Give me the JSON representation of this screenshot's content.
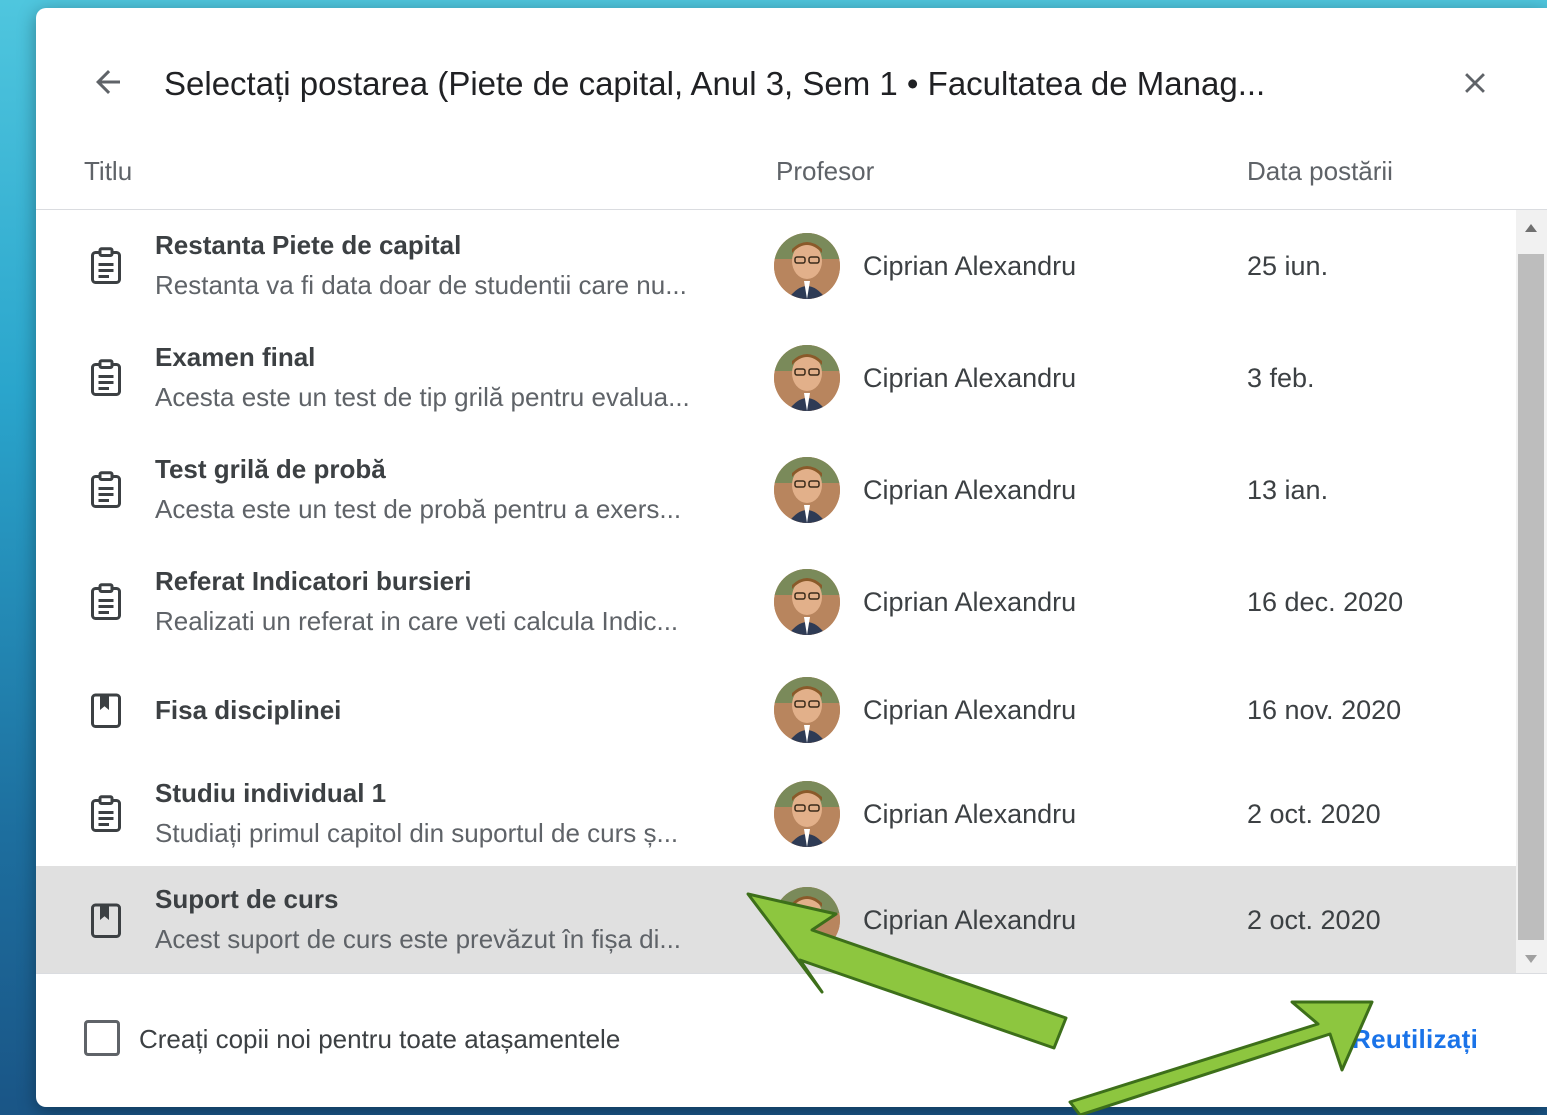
{
  "dialog": {
    "title": "Selectați postarea (Piete de capital, Anul 3, Sem 1 • Facultatea de Manag...",
    "columns": {
      "title": "Titlu",
      "teacher": "Profesor",
      "date": "Data postării"
    },
    "rows": [
      {
        "icon": "assignment-icon",
        "title": "Restanta Piete de capital",
        "subtitle": "Restanta va fi data doar de studentii care nu...",
        "teacher": "Ciprian Alexandru",
        "date": "25 iun."
      },
      {
        "icon": "assignment-icon",
        "title": "Examen final",
        "subtitle": "Acesta este un test de tip grilă pentru evalua...",
        "teacher": "Ciprian Alexandru",
        "date": "3 feb."
      },
      {
        "icon": "assignment-icon",
        "title": "Test grilă de probă",
        "subtitle": "Acesta este un test de probă pentru a exers...",
        "teacher": "Ciprian Alexandru",
        "date": "13 ian."
      },
      {
        "icon": "assignment-icon",
        "title": "Referat Indicatori bursieri",
        "subtitle": "Realizati un referat in care veti calcula Indic...",
        "teacher": "Ciprian Alexandru",
        "date": "16 dec. 2020"
      },
      {
        "icon": "material-icon",
        "title": "Fisa disciplinei",
        "subtitle": "",
        "teacher": "Ciprian Alexandru",
        "date": "16 nov. 2020"
      },
      {
        "icon": "assignment-icon",
        "title": "Studiu individual 1",
        "subtitle": "Studiați primul capitol din suportul de curs ș...",
        "teacher": "Ciprian Alexandru",
        "date": "2 oct. 2020"
      },
      {
        "icon": "material-icon",
        "title": "Suport de curs",
        "subtitle": "Acest suport de curs este prevăzut în fișa di...",
        "teacher": "Ciprian Alexandru",
        "date": "2 oct. 2020",
        "selected": true
      }
    ],
    "footer": {
      "checkbox_label": "Creați copii noi pentru toate atașamentele",
      "checkbox_checked": false,
      "reuse_label": "Reutilizați"
    }
  },
  "colors": {
    "accent": "#1a73e8",
    "selected_row": "#e0e0e0",
    "arrow_fill": "#8dc63f",
    "arrow_stroke": "#3d6f1a"
  }
}
